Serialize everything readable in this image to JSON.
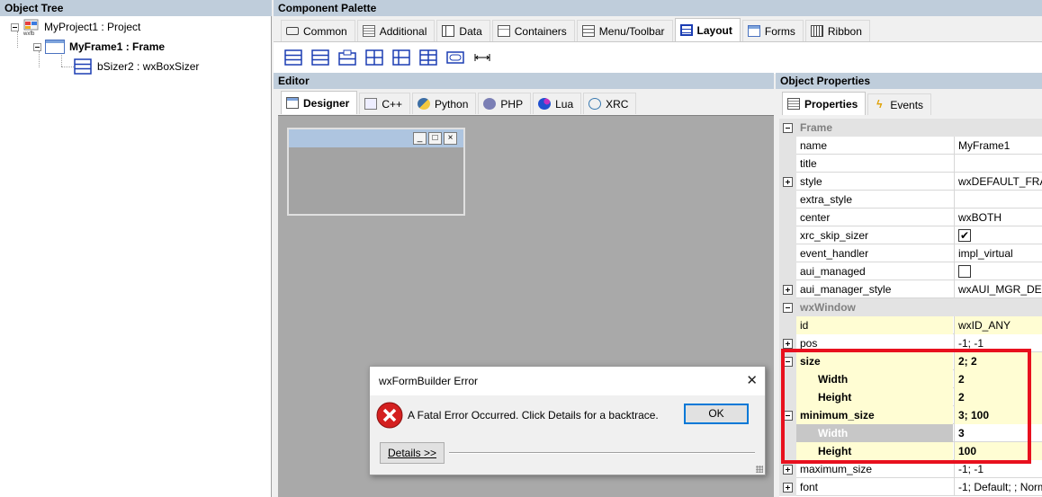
{
  "object_tree": {
    "title": "Object Tree",
    "nodes": [
      {
        "label": "MyProject1 : Project"
      },
      {
        "label": "MyFrame1 : Frame"
      },
      {
        "label": "bSizer2 : wxBoxSizer"
      }
    ]
  },
  "palette": {
    "title": "Component Palette",
    "tabs": [
      "Common",
      "Additional",
      "Data",
      "Containers",
      "Menu/Toolbar",
      "Layout",
      "Forms",
      "Ribbon"
    ],
    "active_tab": "Layout"
  },
  "editor": {
    "title": "Editor",
    "tabs": [
      "Designer",
      "C++",
      "Python",
      "PHP",
      "Lua",
      "XRC"
    ],
    "active_tab": "Designer",
    "preview_buttons": {
      "minimize": "_",
      "maximize": "□",
      "close": "×"
    }
  },
  "object_properties": {
    "title": "Object Properties",
    "tabs": [
      "Properties",
      "Events"
    ],
    "active_tab": "Properties",
    "rows": [
      {
        "name": "Frame",
        "value": "",
        "kind": "category"
      },
      {
        "name": "name",
        "value": "MyFrame1"
      },
      {
        "name": "title",
        "value": ""
      },
      {
        "name": "style",
        "value": "wxDEFAULT_FRAM",
        "expand": "plus"
      },
      {
        "name": "extra_style",
        "value": ""
      },
      {
        "name": "center",
        "value": "wxBOTH"
      },
      {
        "name": "xrc_skip_sizer",
        "value": "✔",
        "kind": "checkbox"
      },
      {
        "name": "event_handler",
        "value": "impl_virtual"
      },
      {
        "name": "aui_managed",
        "value": "",
        "kind": "checkbox"
      },
      {
        "name": "aui_manager_style",
        "value": "wxAUI_MGR_DEFA",
        "expand": "plus"
      },
      {
        "name": "wxWindow",
        "value": "",
        "kind": "category"
      },
      {
        "name": "id",
        "value": "wxID_ANY",
        "highlight": true
      },
      {
        "name": "pos",
        "value": "-1; -1",
        "expand": "plus"
      },
      {
        "name": "size",
        "value": "2; 2",
        "expand": "minus",
        "highlight": true,
        "bold": true
      },
      {
        "name": "Width",
        "value": "2",
        "highlight": true,
        "bold": true,
        "sub": true
      },
      {
        "name": "Height",
        "value": "2",
        "highlight": true,
        "bold": true,
        "sub": true
      },
      {
        "name": "minimum_size",
        "value": "3; 100",
        "expand": "minus",
        "highlight": true,
        "bold": true
      },
      {
        "name": "Width",
        "value": "3",
        "bold": true,
        "sub": true,
        "selected": true
      },
      {
        "name": "Height",
        "value": "100",
        "highlight": true,
        "bold": true,
        "sub": true
      },
      {
        "name": "maximum_size",
        "value": "-1; -1",
        "expand": "plus"
      },
      {
        "name": "font",
        "value": "-1; Default; ; Norm",
        "expand": "plus"
      }
    ]
  },
  "error_dialog": {
    "title": "wxFormBuilder Error",
    "message": "A Fatal Error Occurred. Click Details for a backtrace.",
    "ok_label": "OK",
    "details_label": "Details >>",
    "close_glyph": "✕"
  },
  "colors": {
    "panel_header": "#bfcddb",
    "highlight_box": "#e8101e",
    "error_red": "#d42020",
    "canvas": "#a9a9a9"
  }
}
